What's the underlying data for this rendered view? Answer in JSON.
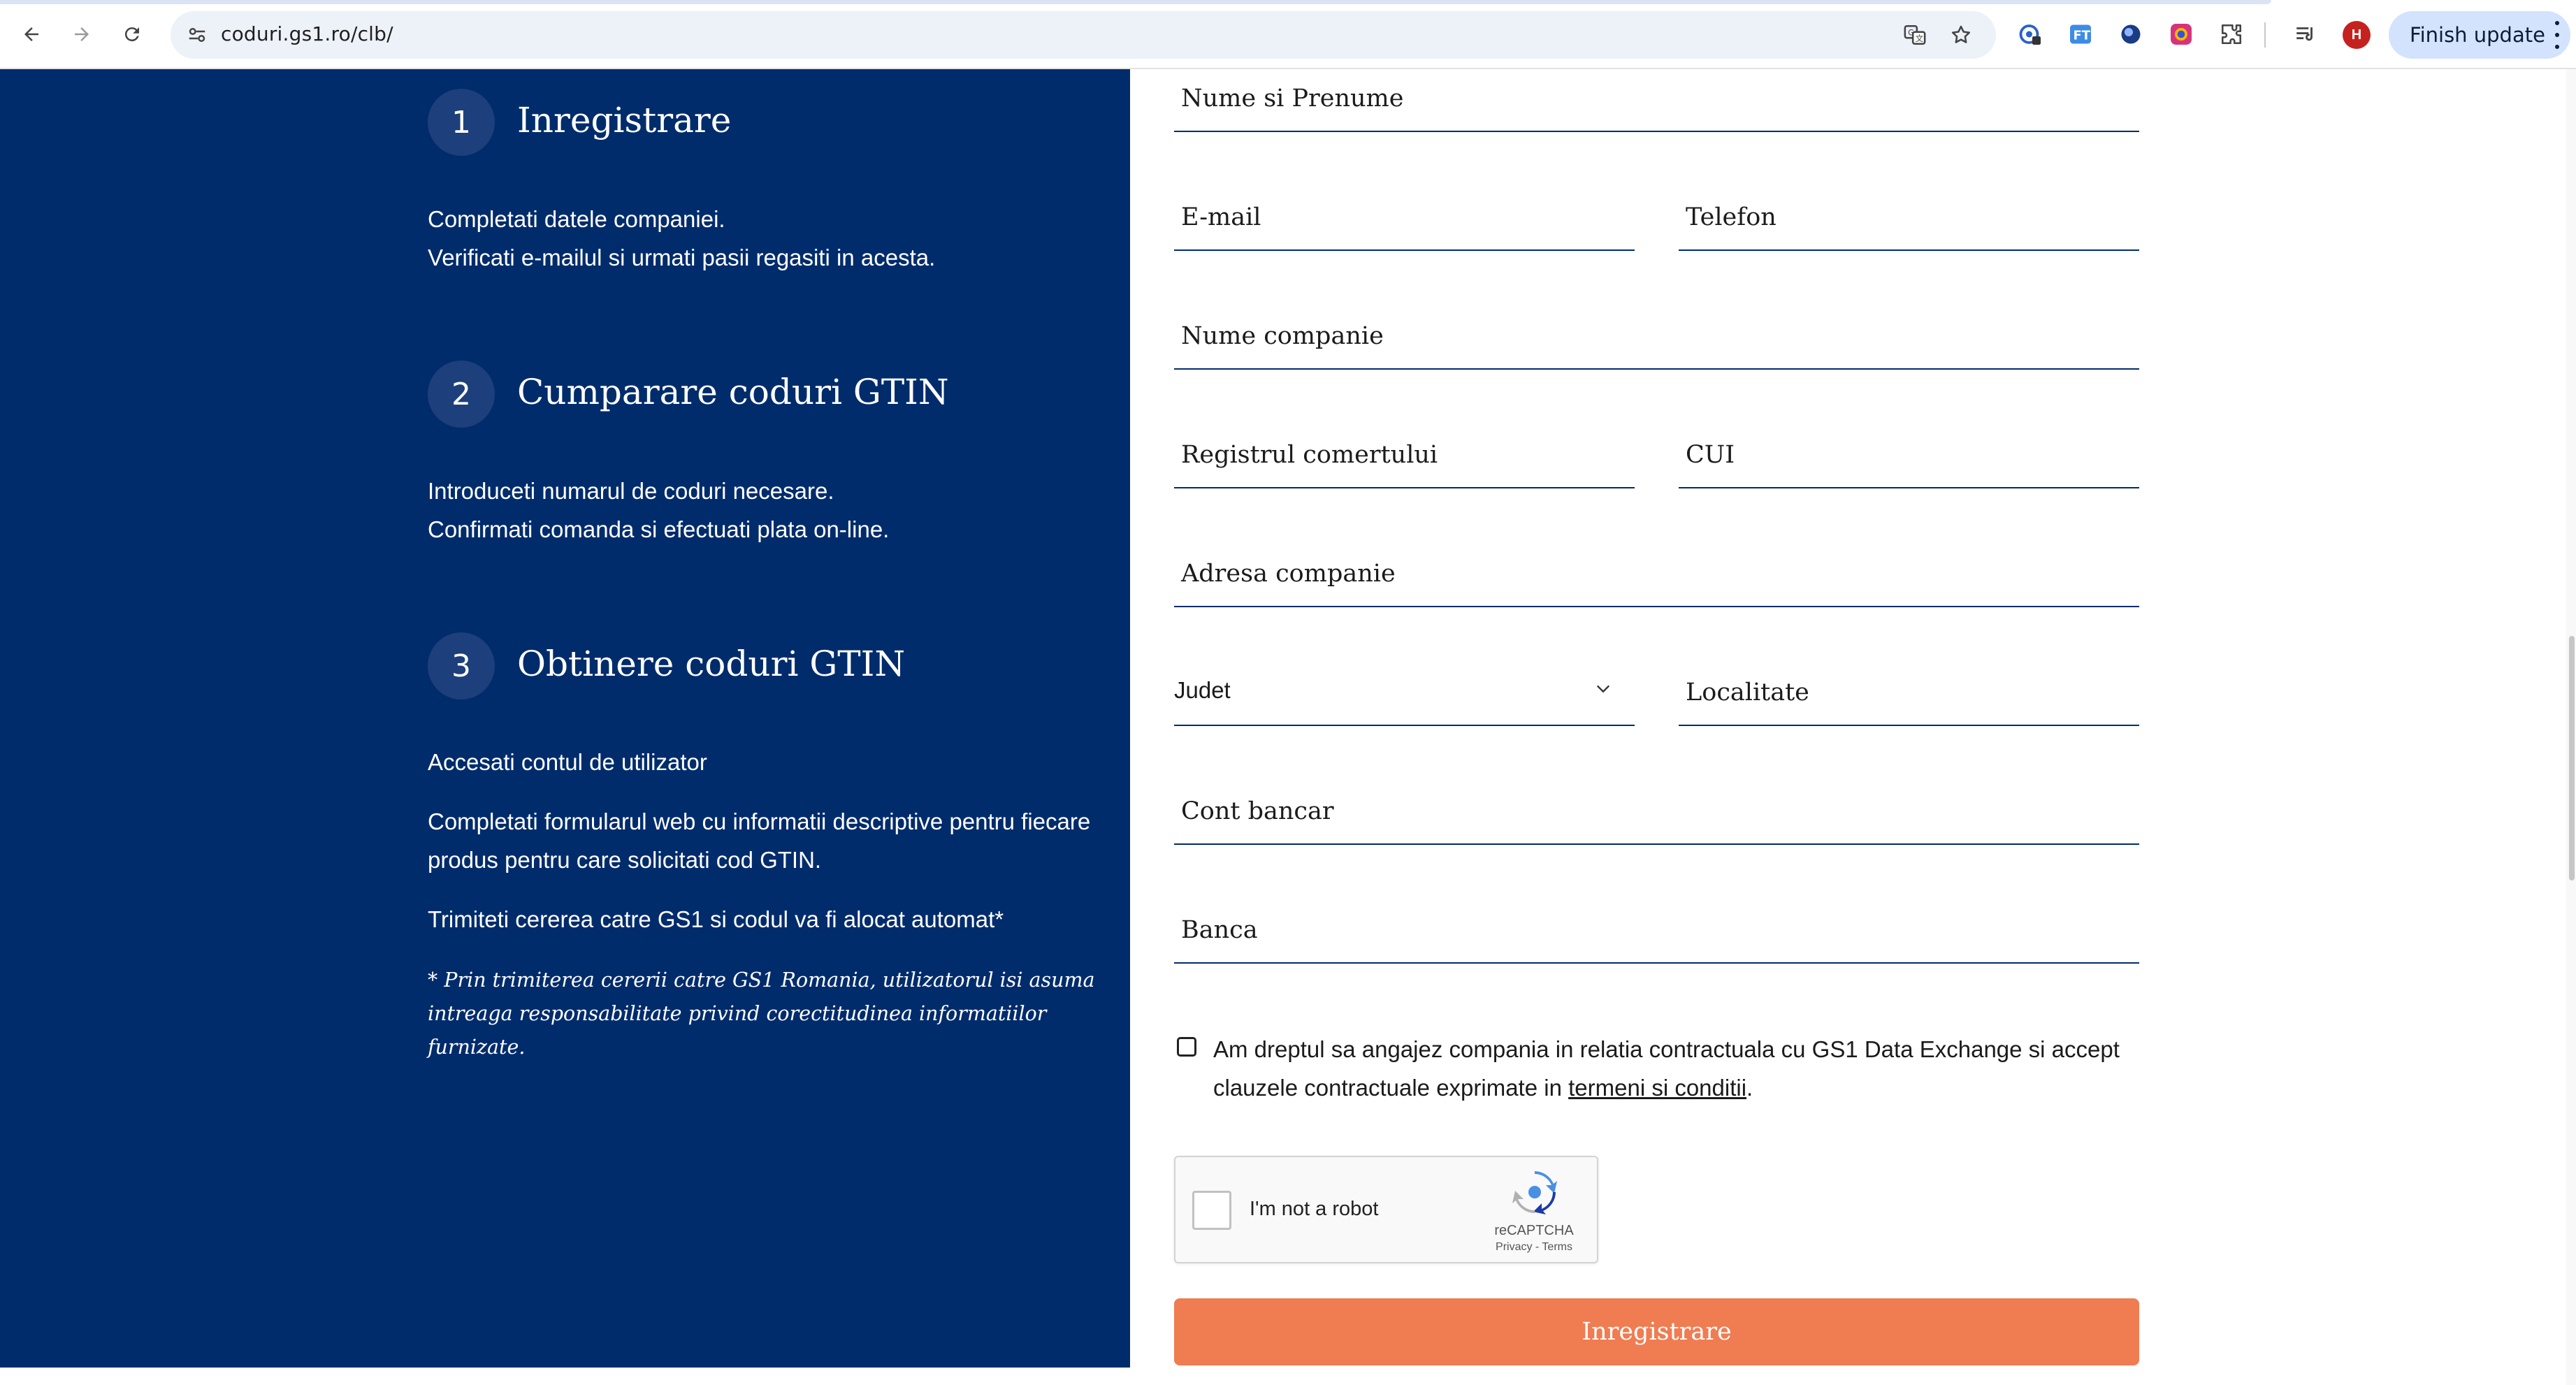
{
  "browser": {
    "url": "coduri.gs1.ro/clb/",
    "profile_initial": "H",
    "finish_update_label": "Finish update",
    "colors": {
      "profile": "#c5221f",
      "update_pill": "#d3e3fd"
    }
  },
  "left": {
    "background": "#002c6c",
    "steps": [
      {
        "number": "1",
        "title": "Inregistrare",
        "lines": [
          "Completati datele companiei.",
          "Verificati e-mailul si urmati pasii regasiti in acesta."
        ]
      },
      {
        "number": "2",
        "title": "Cumparare coduri GTIN",
        "lines": [
          "Introduceti numarul de coduri necesare.",
          "Confirmati comanda si efectuati plata on-line."
        ]
      },
      {
        "number": "3",
        "title": "Obtinere coduri GTIN",
        "lines": [
          "Accesati contul de utilizator",
          "Completati formularul web cu informatii descriptive pentru fiecare produs pentru care solicitati cod GTIN.",
          "Trimiteti cererea catre GS1 si codul va fi alocat automat*"
        ]
      }
    ],
    "note": "* Prin trimiterea cererii catre GS1 Romania, utilizatorul isi asuma intreaga responsabilitate privind corectitudinea informatiilor furnizate."
  },
  "form": {
    "full_name": "Nume si Prenume",
    "email": "E-mail",
    "phone": "Telefon",
    "company_name": "Nume companie",
    "trade_register": "Registrul comertului",
    "cui": "CUI",
    "company_address": "Adresa companie",
    "county": "Judet",
    "city": "Localitate",
    "bank_account": "Cont bancar",
    "bank": "Banca",
    "agree_text_before": "Am dreptul sa angajez compania in relatia contractuala cu GS1 Data Exchange si accept clauzele contractuale exprimate in ",
    "agree_link": "termeni si conditii",
    "agree_text_after": ".",
    "recaptcha": {
      "label": "I'm not a robot",
      "brand": "reCAPTCHA",
      "links": "Privacy - Terms"
    },
    "submit_label": "Inregistrare",
    "accent_color": "#f07c51"
  }
}
